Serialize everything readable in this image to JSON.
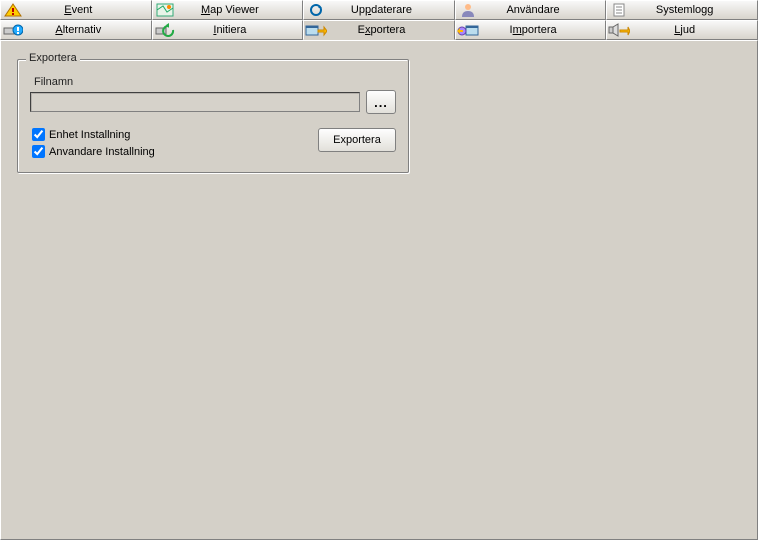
{
  "tabs_row1": [
    {
      "label": "Event",
      "accesskey": "E"
    },
    {
      "label": "Map Viewer",
      "accesskey": "M"
    },
    {
      "label": "Uppdaterare",
      "accesskey": "p"
    },
    {
      "label": "Användare",
      "accesskey": ""
    },
    {
      "label": "Systemlogg",
      "accesskey": ""
    }
  ],
  "tabs_row2": [
    {
      "label": "Alternativ",
      "accesskey": "A"
    },
    {
      "label": "Initiera",
      "accesskey": "I"
    },
    {
      "label": "Exportera",
      "accesskey": "x",
      "active": true
    },
    {
      "label": "Importera",
      "accesskey": "m"
    },
    {
      "label": "Ljud",
      "accesskey": "L"
    }
  ],
  "groupbox": {
    "legend": "Exportera",
    "filename_label": "Filnamn",
    "filename_value": "",
    "browse_label": "...",
    "checkbox_device": {
      "label": "Enhet Installning",
      "checked": true
    },
    "checkbox_user": {
      "label": "Anvandare Installning",
      "checked": true
    },
    "export_button": "Exportera"
  }
}
